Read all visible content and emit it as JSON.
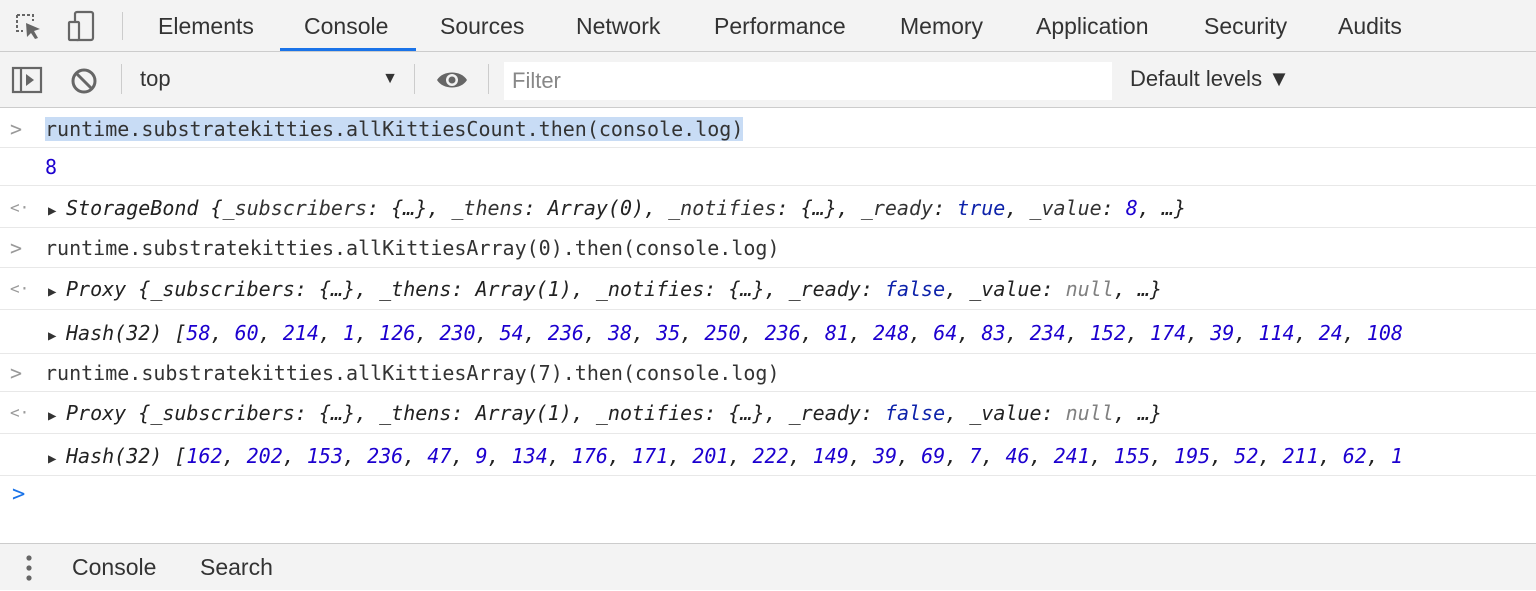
{
  "tabs": [
    "Elements",
    "Console",
    "Sources",
    "Network",
    "Performance",
    "Memory",
    "Application",
    "Security",
    "Audits"
  ],
  "active_tab": "Console",
  "toolbar": {
    "context": "top",
    "filter_placeholder": "Filter",
    "levels_label": "Default levels ▼"
  },
  "console": {
    "cmd1": "runtime.substratekitties.allKittiesCount.then(console.log)",
    "out1": "8",
    "ret1": {
      "name": "StorageBond",
      "subscribers_key": "_subscribers",
      "thens_key": "_thens",
      "thens_val": "Array(0)",
      "notifies_key": "_notifies",
      "ready_key": "_ready",
      "ready_val": "true",
      "value_key": "_value",
      "value_val": "8",
      "obj_placeholder": "{…}"
    },
    "cmd2": "runtime.substratekitties.allKittiesArray(0).then(console.log)",
    "ret2": {
      "name": "Proxy",
      "thens_val": "Array(1)",
      "ready_val": "false",
      "value_val": "null"
    },
    "hash1": {
      "label": "Hash(32)",
      "values": [
        "58",
        "60",
        "214",
        "1",
        "126",
        "230",
        "54",
        "236",
        "38",
        "35",
        "250",
        "236",
        "81",
        "248",
        "64",
        "83",
        "234",
        "152",
        "174",
        "39",
        "114",
        "24",
        "108"
      ]
    },
    "cmd3": "runtime.substratekitties.allKittiesArray(7).then(console.log)",
    "ret3": {
      "name": "Proxy",
      "thens_val": "Array(1)",
      "ready_val": "false",
      "value_val": "null"
    },
    "hash2": {
      "label": "Hash(32)",
      "values": [
        "162",
        "202",
        "153",
        "236",
        "47",
        "9",
        "134",
        "176",
        "171",
        "201",
        "222",
        "149",
        "39",
        "69",
        "7",
        "46",
        "241",
        "155",
        "195",
        "52",
        "211",
        "62",
        "1"
      ]
    }
  },
  "drawer": {
    "tabs": [
      "Console",
      "Search"
    ]
  },
  "colors": {
    "accent": "#1a73e8",
    "number": "#1c00cf",
    "selection": "#c8dcf5"
  },
  "icons": [
    "inspect-element-icon",
    "device-toolbar-icon",
    "sidebar-toggle-icon",
    "clear-console-icon",
    "eye-icon",
    "kebab-menu-icon"
  ]
}
